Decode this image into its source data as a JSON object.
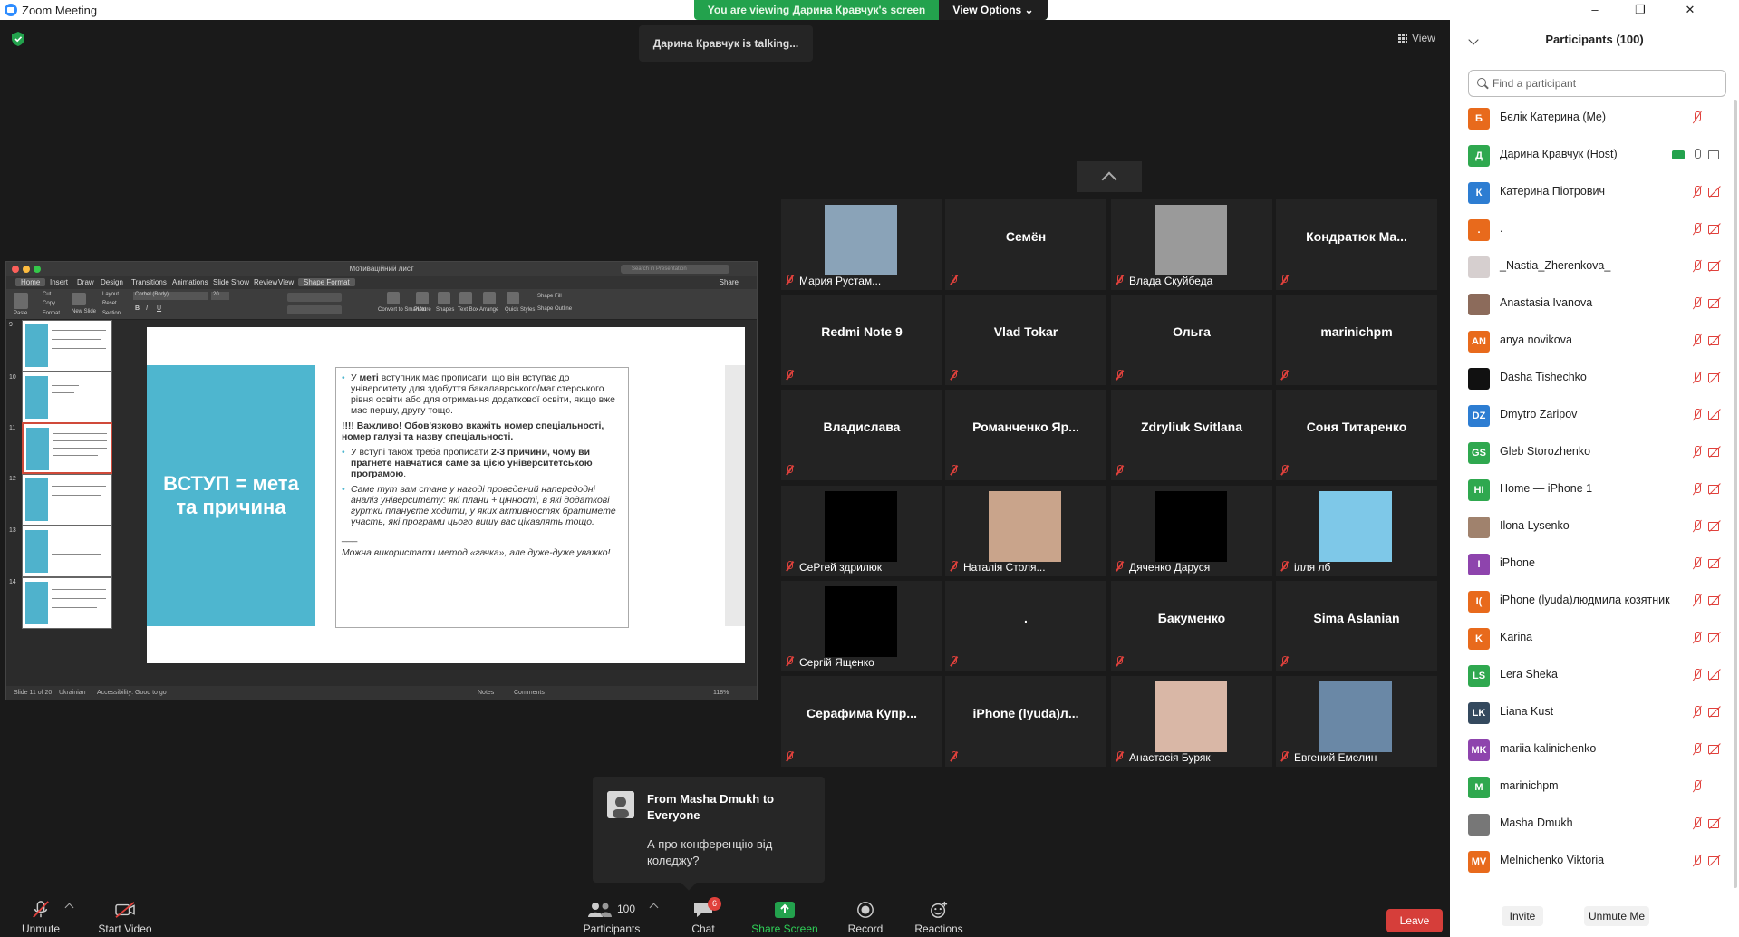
{
  "window": {
    "title": "Zoom Meeting",
    "min": "–",
    "max": "❐",
    "close": "✕"
  },
  "banner": {
    "message": "You are viewing Дарина Кравчук's screen",
    "view_options": "View Options ⌄"
  },
  "talking": "Дарина Кравчук is talking...",
  "view_button": "View",
  "shared_screen": {
    "doc_title": "Мотиваційний лист",
    "search_placeholder": "Search in Presentation",
    "share_label": "Share",
    "tabs": [
      "Home",
      "Insert",
      "Draw",
      "Design",
      "Transitions",
      "Animations",
      "Slide Show",
      "Review",
      "View",
      "Shape Format"
    ],
    "ribbon": {
      "paste": "Paste",
      "cut": "Cut",
      "copy": "Copy",
      "format": "Format",
      "new_slide": "New Slide",
      "layout": "Layout",
      "reset": "Reset",
      "section": "Section",
      "font": "Corbel (Body)",
      "size": "20",
      "convert": "Convert to SmartArt",
      "picture": "Picture",
      "shapes": "Shapes",
      "textbox": "Text Box",
      "arrange": "Arrange",
      "quick": "Quick Styles",
      "fill": "Shape Fill",
      "outline": "Shape Outline"
    },
    "thumb_numbers": [
      "9",
      "10",
      "11",
      "12",
      "13",
      "14"
    ],
    "slide": {
      "title": "ВСТУП = мета та причина",
      "p1_pre": "У ",
      "p1_bold": "меті",
      "p1_post": " вступник має прописати, що він вступає до університету для здобуття бакалаврського/магістерського рівня освіти або для отримання додаткової освіти, якщо вже має першу, другу тощо.",
      "p2": "!!!! Важливо! Обов'язково вкажіть номер спеціальності, номер галузі та назву спеціальності.",
      "p3_pre": "У вступі також треба прописати ",
      "p3_bold": "2-3 причини, чому ви прагнете навчатися саме за цією університетською програмою",
      "p3_post": ".",
      "p4": "Саме тут вам стане у нагоді проведений напередодні аналіз університету: які плани + цінності, в які додаткові гуртки плануєте ходити, у яких активностях братимете участь, які програми цього вишу вас цікавлять тощо.",
      "sep": "___",
      "p5": "Можна використати  метод «гачка», але дуже-дуже уважко!"
    },
    "status": {
      "slide": "Slide 11 of 20",
      "lang": "Ukrainian",
      "access": "Accessibility: Good to go",
      "notes": "Notes",
      "comments": "Comments",
      "zoom": "118%"
    }
  },
  "tiles": [
    {
      "name": "Мария Рустам...",
      "has_photo": true,
      "color": "#8aa3b8"
    },
    {
      "name": "Семён",
      "has_photo": false
    },
    {
      "name": "Влада Скуйбеда",
      "has_photo": true,
      "color": "#9a9a9a"
    },
    {
      "name": "Кондратюк  Ма...",
      "has_photo": false
    },
    {
      "name": "Redmi Note 9",
      "has_photo": false
    },
    {
      "name": "Vlad Tokar",
      "has_photo": false
    },
    {
      "name": "Ольга",
      "has_photo": false
    },
    {
      "name": "marinichpm",
      "has_photo": false
    },
    {
      "name": "Владислава",
      "has_photo": false
    },
    {
      "name": "Романченко  Яр...",
      "has_photo": false
    },
    {
      "name": "Zdryliuk Svitlana",
      "has_photo": false
    },
    {
      "name": "Соня Титаренко",
      "has_photo": false
    },
    {
      "name": "СеРгей здрилюк",
      "has_photo": true,
      "color": "#000"
    },
    {
      "name": "Наталія Столя...",
      "has_photo": true,
      "color": "#c9a48b"
    },
    {
      "name": "Дяченко Даруся",
      "has_photo": true,
      "color": "#000"
    },
    {
      "name": "ілля лб",
      "has_photo": true,
      "color": "#7ec8e8"
    },
    {
      "name": "Сергій Ященко",
      "has_photo": true,
      "color": "#000"
    },
    {
      "name": ".",
      "has_photo": false
    },
    {
      "name": "Бакуменко",
      "has_photo": false
    },
    {
      "name": "Sima Aslanian",
      "has_photo": false
    },
    {
      "name": "Серафима  Купр...",
      "has_photo": false
    },
    {
      "name": "iPhone  (lyuda)л...",
      "has_photo": false
    },
    {
      "name": "Анастасія Буряк",
      "has_photo": true,
      "color": "#d9b7a6"
    },
    {
      "name": "Евгений Емелин",
      "has_photo": true,
      "color": "#6a88a6"
    }
  ],
  "chat_popup": {
    "from": "From Masha Dmukh to Everyone",
    "text": "А про конференцію від коледжу?"
  },
  "toolbar": {
    "unmute": "Unmute",
    "start_video": "Start Video",
    "participants": "Participants",
    "participants_count": "100",
    "chat": "Chat",
    "chat_badge": "6",
    "share": "Share Screen",
    "record": "Record",
    "reactions": "Reactions",
    "leave": "Leave"
  },
  "panel": {
    "title": "Participants (100)",
    "find_placeholder": "Find a participant",
    "participants": [
      {
        "initial": "Б",
        "name": "Бєлік Катерина (Me)",
        "color": "#e86a1c",
        "mic": "off",
        "cam": "none"
      },
      {
        "initial": "Д",
        "name": "Дарина Кравчук (Host)",
        "color": "#2fa84f",
        "mic": "on",
        "cam": "on",
        "share": true
      },
      {
        "initial": "К",
        "name": " Катерина Піотрович",
        "color": "#2d7dd2",
        "mic": "off",
        "cam": "off"
      },
      {
        "initial": ".",
        "name": ".",
        "color": "#e86a1c",
        "mic": "off",
        "cam": "off"
      },
      {
        "initial": "",
        "name": "_Nastia_Zherenkova_",
        "color": "#d6cfcf",
        "mic": "off",
        "cam": "off"
      },
      {
        "initial": "",
        "name": "Anastasia Ivanova",
        "color": "#8c6b5b",
        "mic": "off",
        "cam": "off"
      },
      {
        "initial": "AN",
        "name": "anya novikova",
        "color": "#e86a1c",
        "mic": "off",
        "cam": "off"
      },
      {
        "initial": "",
        "name": "Dasha Tishechko",
        "color": "#111",
        "mic": "off",
        "cam": "off"
      },
      {
        "initial": "DZ",
        "name": "Dmytro Zaripov",
        "color": "#2d7dd2",
        "mic": "off",
        "cam": "off"
      },
      {
        "initial": "GS",
        "name": "Gleb Storozhenko",
        "color": "#2fa84f",
        "mic": "off",
        "cam": "off"
      },
      {
        "initial": "HI",
        "name": "Home — iPhone 1",
        "color": "#2fa84f",
        "mic": "off",
        "cam": "off"
      },
      {
        "initial": "",
        "name": "Ilona Lysenko",
        "color": "#a0826d",
        "mic": "off",
        "cam": "off"
      },
      {
        "initial": "I",
        "name": "iPhone",
        "color": "#8e44ad",
        "mic": "off",
        "cam": "off"
      },
      {
        "initial": "I(",
        "name": "iPhone (lyuda)людмила козятник",
        "color": "#e86a1c",
        "mic": "off",
        "cam": "off"
      },
      {
        "initial": "K",
        "name": "Karina",
        "color": "#e86a1c",
        "mic": "off",
        "cam": "off"
      },
      {
        "initial": "LS",
        "name": "Lera Sheka",
        "color": "#2fa84f",
        "mic": "off",
        "cam": "off"
      },
      {
        "initial": "LK",
        "name": "Liana Kust",
        "color": "#34495e",
        "mic": "off",
        "cam": "off"
      },
      {
        "initial": "MK",
        "name": "mariia kalinichenko",
        "color": "#8e44ad",
        "mic": "off",
        "cam": "off"
      },
      {
        "initial": "M",
        "name": "marinichpm",
        "color": "#2fa84f",
        "mic": "off",
        "cam": "none"
      },
      {
        "initial": "",
        "name": "Masha Dmukh",
        "color": "#777",
        "mic": "off",
        "cam": "off"
      },
      {
        "initial": "MV",
        "name": "Melnichenko Viktoria",
        "color": "#e86a1c",
        "mic": "off",
        "cam": "off"
      }
    ],
    "invite": "Invite",
    "unmute_me": "Unmute Me"
  }
}
